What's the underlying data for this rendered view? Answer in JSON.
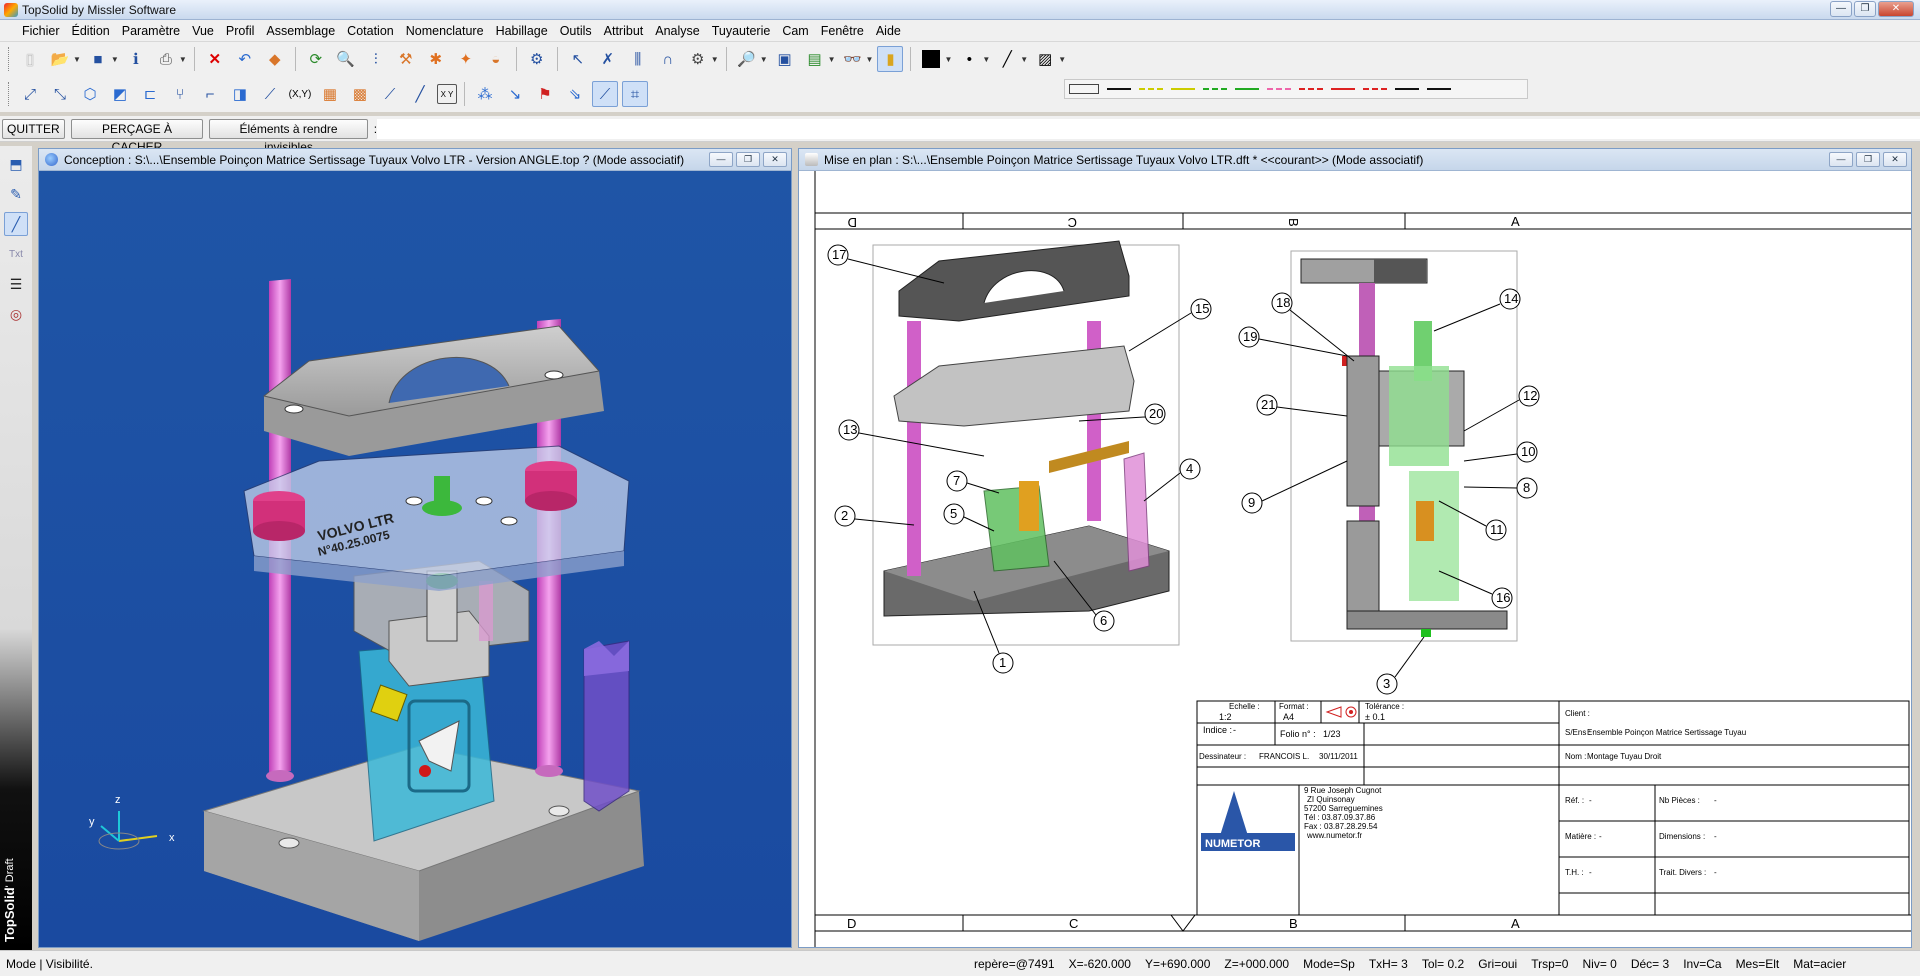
{
  "app": {
    "title": "TopSolid by Missler Software"
  },
  "menu": [
    "Fichier",
    "Édition",
    "Paramètre",
    "Vue",
    "Profil",
    "Assemblage",
    "Cotation",
    "Nomenclature",
    "Habillage",
    "Outils",
    "Attribut",
    "Analyse",
    "Tuyauterie",
    "Cam",
    "Fenêtre",
    "Aide"
  ],
  "toolbar2": {
    "xy_label": "(X,Y)",
    "xy_grid": "X Y"
  },
  "command": {
    "quit": "QUITTER",
    "hole": "PERÇAGE À CACHER",
    "invisible": "Éléments à rendre invisibles",
    "prompt": ":"
  },
  "left_brand": {
    "name": "TopSolid",
    "mode": "' Draft"
  },
  "design_window": {
    "title": "Conception : S:\\...\\Ensemble Poinçon Matrice Sertissage Tuyaux Volvo LTR - Version ANGLE.top  ? (Mode associatif)",
    "engraving_1": "VOLVO LTR",
    "engraving_2": "N°40.25.0075",
    "axis_x": "x",
    "axis_y": "y",
    "axis_z": "z"
  },
  "draft_window": {
    "title": "Mise en plan : S:\\...\\Ensemble Poinçon Matrice Sertissage Tuyaux Volvo LTR.dft  *  <<courant>> (Mode associatif)",
    "zones": [
      "D",
      "C",
      "B",
      "A"
    ],
    "balloons_left": [
      "17",
      "15",
      "13",
      "20",
      "7",
      "4",
      "2",
      "5",
      "6",
      "1"
    ],
    "balloons_right": [
      "18",
      "14",
      "19",
      "12",
      "21",
      "10",
      "8",
      "9",
      "11",
      "16",
      "3"
    ],
    "titleblock": {
      "echelle_label": "Echelle :",
      "echelle": "1:2",
      "format_label": "Format :",
      "format": "A4",
      "tolerance_label": "Tolérance :",
      "tolerance": "± 0.1",
      "indice_label": "Indice :",
      "indice": "-",
      "folio_label": "Folio n° :",
      "folio": "1/23",
      "client_label": "Client :",
      "designation_label": "S/Ens :",
      "designation": "Ensemble  Poinçon  Matrice  Sertissage  Tuyau",
      "dessinateur_label": "Dessinateur :",
      "dessinateur": "FRANCOIS  L.",
      "date": "30/11/2011",
      "nom_label": "Nom :",
      "nom": "Montage  Tuyau  Droit",
      "address": [
        "9 Rue Joseph Cugnot",
        "ZI Quinsonay",
        "57200 Sarreguemines",
        "Tél : 03.87.09.37.86",
        "Fax : 03.87.28.29.54",
        "www.numetor.fr"
      ],
      "logo": "NUMETOR",
      "ref_label": "Réf. :",
      "ref": "-",
      "matiere_label": "Matière :",
      "matiere": "-",
      "th_label": "T.H. :",
      "th": "-",
      "nb_pieces_label": "Nb Pièces :",
      "nb_pieces": "-",
      "dimensions_label": "Dimensions :",
      "dimensions": "-",
      "trait_label": "Trait. Divers :",
      "trait": "-"
    }
  },
  "status": {
    "left": "Mode | Visibilité.",
    "right": [
      "repère=@7491",
      "X=-620.000",
      "Y=+690.000",
      "Z=+000.000",
      "Mode=Sp",
      "TxH= 3",
      "Tol= 0.2",
      "Gri=oui",
      "Trsp=0",
      "Niv= 0",
      "Déc= 3",
      "Inv=Ca",
      "Mes=Elt",
      "Mat=acier"
    ]
  }
}
